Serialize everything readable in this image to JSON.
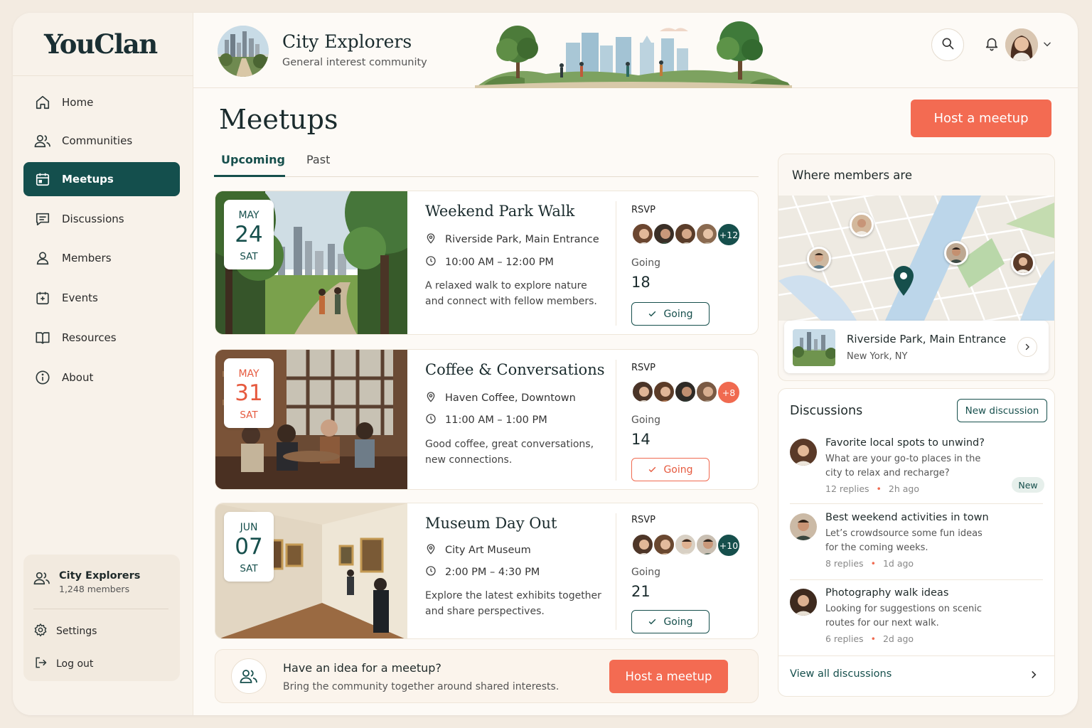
{
  "app": {
    "name": "YouClan"
  },
  "sidebar": {
    "items": [
      {
        "label": "Home"
      },
      {
        "label": "Communities"
      },
      {
        "label": "Meetups"
      },
      {
        "label": "Discussions"
      },
      {
        "label": "Members"
      },
      {
        "label": "Events"
      },
      {
        "label": "Resources"
      },
      {
        "label": "About"
      }
    ],
    "community": {
      "name": "City Explorers",
      "members": "1,248 members"
    },
    "settings": "Settings",
    "logout": "Log out"
  },
  "header": {
    "title": "City Explorers",
    "subtitle": "General interest community"
  },
  "main": {
    "title": "Meetups",
    "host_button": "Host a meetup",
    "tabs": [
      {
        "label": "Upcoming"
      },
      {
        "label": "Past"
      }
    ],
    "rsvp_label": "RSVP",
    "going_label": "Going",
    "going_button": "Going",
    "meetups": [
      {
        "month": "MAY",
        "day": "24",
        "weekday": "SAT",
        "title": "Weekend Park Walk",
        "location": "Riverside Park, Main Entrance",
        "time": "10:00 AM – 12:00 PM",
        "description": "A relaxed walk to explore nature and connect with fellow members.",
        "extra": "+12",
        "going": "18"
      },
      {
        "month": "MAY",
        "day": "31",
        "weekday": "SAT",
        "title": "Coffee & Conversations",
        "location": "Haven Coffee, Downtown",
        "time": "11:00 AM – 1:00 PM",
        "description": "Good coffee, great conversations, new connections.",
        "extra": "+8",
        "going": "14"
      },
      {
        "month": "JUN",
        "day": "07",
        "weekday": "SAT",
        "title": "Museum Day Out",
        "location": "City Art Museum",
        "time": "2:00 PM – 4:30 PM",
        "description": "Explore the latest exhibits together and share perspectives.",
        "extra": "+10",
        "going": "21"
      }
    ],
    "idea": {
      "title": "Have an idea for a meetup?",
      "subtitle": "Bring the community together around shared interests.",
      "button": "Host a meetup"
    }
  },
  "map_panel": {
    "title": "Where members are",
    "location": "Riverside Park, Main Entrance",
    "city": "New York, NY"
  },
  "discussions": {
    "title": "Discussions",
    "new_button": "New discussion",
    "items": [
      {
        "title": "Favorite local spots to unwind?",
        "body": "What are your go-to places in the city to relax and recharge?",
        "replies": "12 replies",
        "age": "2h ago",
        "badge": "New"
      },
      {
        "title": "Best weekend activities in town",
        "body": "Let’s crowdsource some fun ideas for the coming weeks.",
        "replies": "8 replies",
        "age": "1d ago"
      },
      {
        "title": "Photography walk ideas",
        "body": "Looking for suggestions on scenic routes for our next walk.",
        "replies": "6 replies",
        "age": "2d ago"
      }
    ],
    "view_all": "View all discussions"
  },
  "colors": {
    "accent": "#144f4d",
    "cta": "#f36b52",
    "background": "#fdfaf6"
  },
  "icons": [
    "home-icon",
    "users-icon",
    "calendar-icon",
    "chat-icon",
    "user-icon",
    "calendar-check-icon",
    "book-icon",
    "info-icon",
    "search-icon",
    "bell-icon",
    "chevron-down-icon",
    "pin-icon",
    "clock-icon",
    "check-icon",
    "gear-icon",
    "logout-icon",
    "chevron-right-icon"
  ]
}
